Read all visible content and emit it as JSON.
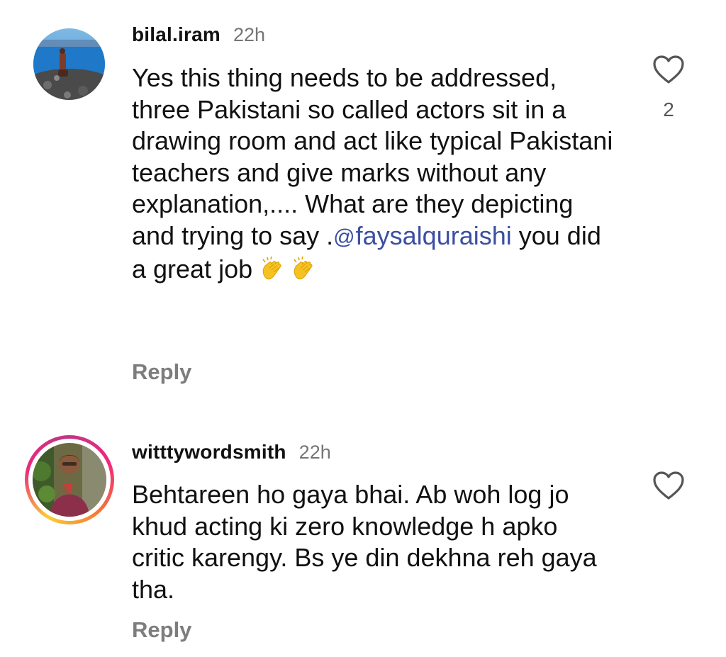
{
  "comments": [
    {
      "username": "bilal.iram",
      "time": "22h",
      "text_before": "Yes this thing needs to be addressed, three Pakistani so called actors sit in a drawing room and act like typical Pakistani teachers and give marks without any explanation,.... What are they depicting and trying to say .",
      "mention": "faysalquraishi",
      "mention_prefix": "@",
      "text_after": " you did a great job ",
      "emojis": [
        "clapping-hands",
        "clapping-hands"
      ],
      "reply_label": "Reply",
      "like_count": "2",
      "icons": {
        "like": "heart-outline-icon"
      }
    },
    {
      "username": "witttywordsmith",
      "time": "22h",
      "text": "Behtareen ho gaya bhai. Ab woh log jo khud acting ki zero knowledge h apko critic karengy. Bs ye din dekhna reh gaya tha.",
      "reply_label": "Reply",
      "has_story_ring": true,
      "icons": {
        "like": "heart-outline-icon"
      }
    }
  ],
  "colors": {
    "text": "#111111",
    "muted": "#757575",
    "reply": "#7d7d7d",
    "mention": "#3b4fa0"
  }
}
